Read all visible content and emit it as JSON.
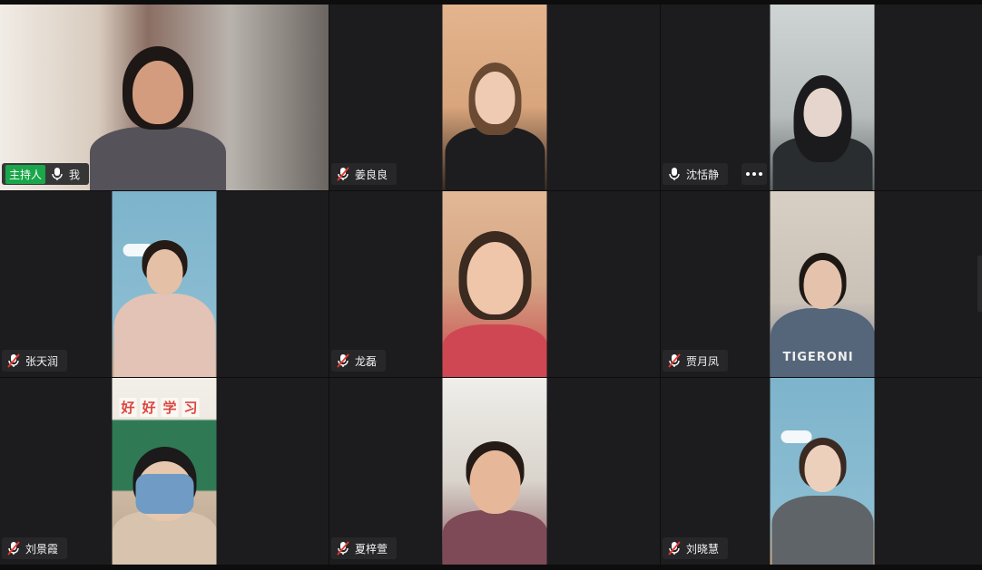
{
  "participants": [
    {
      "name": "我",
      "host_label": "主持人",
      "muted": false
    },
    {
      "name": "姜良良",
      "muted": true
    },
    {
      "name": "沈恬静",
      "muted": false
    },
    {
      "name": "张天润",
      "muted": true
    },
    {
      "name": "龙磊",
      "muted": true
    },
    {
      "name": "贾月凤",
      "muted": true
    },
    {
      "name": "刘景霞",
      "muted": true
    },
    {
      "name": "夏梓萱",
      "muted": true
    },
    {
      "name": "刘晓慧",
      "muted": true
    }
  ],
  "poster_text": [
    "好",
    "好",
    "学",
    "习"
  ],
  "sweater_text": "TIGERONI",
  "colors": {
    "host_badge": "#1aa64a",
    "muted_slash": "#e8372c",
    "label_bg": "#28282a",
    "tile_bg": "#1c1c1e"
  },
  "icons": {
    "mic": "microphone-icon",
    "mic_muted": "microphone-muted-icon",
    "more": "more-options-icon"
  }
}
